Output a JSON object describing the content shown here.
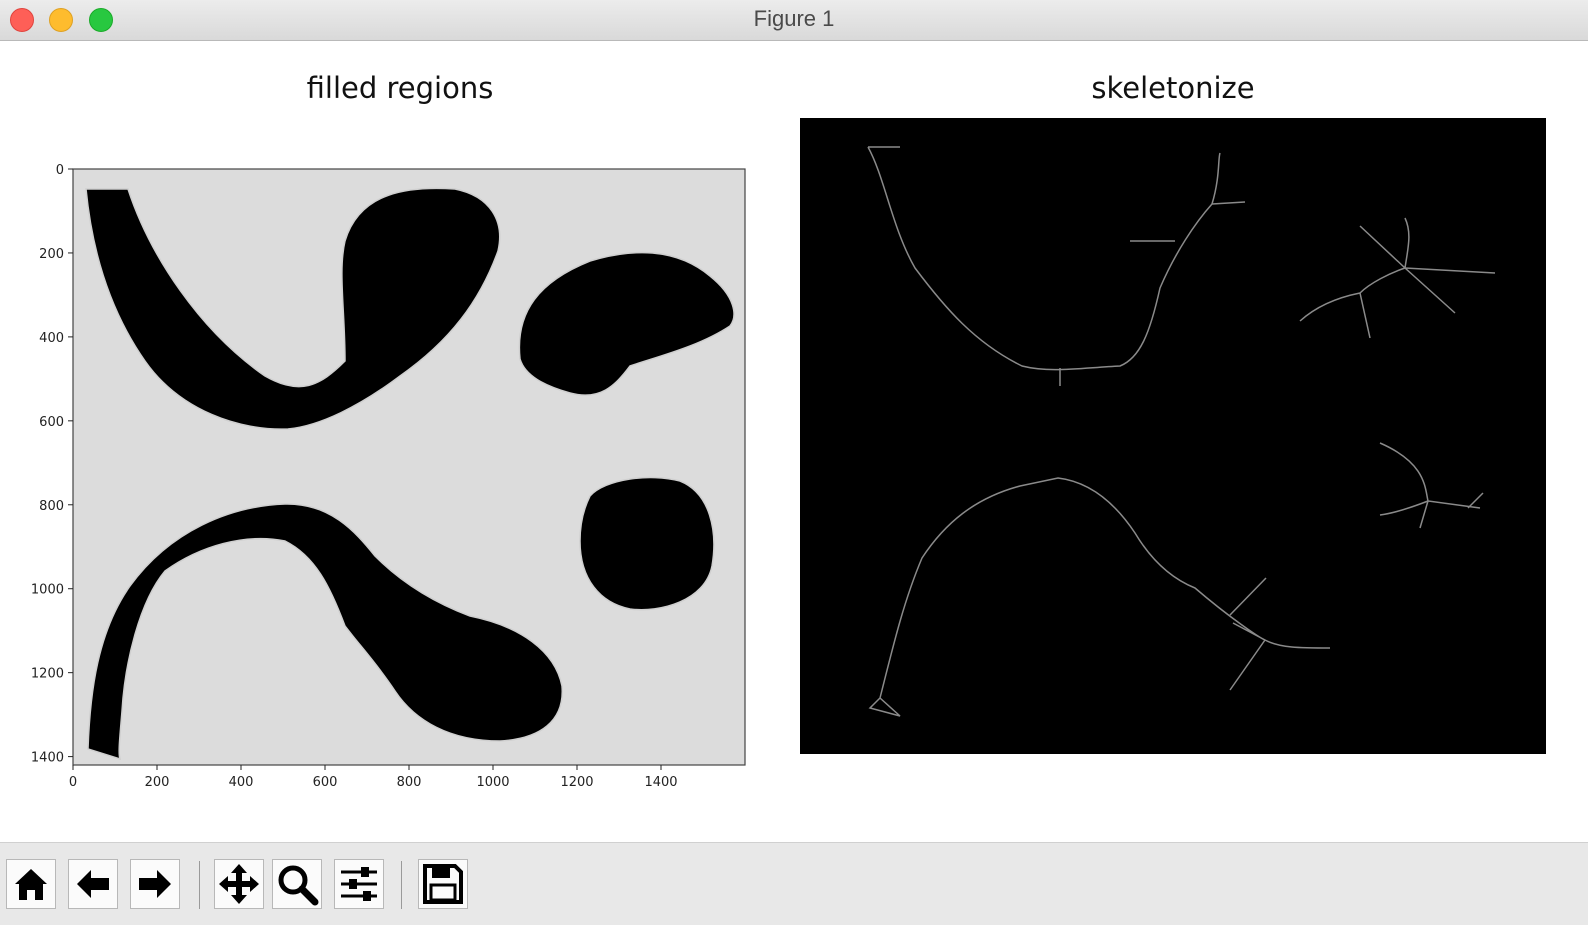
{
  "window": {
    "title": "Figure 1"
  },
  "left_axes": {
    "title": "filled regions",
    "xticks": [
      "0",
      "200",
      "400",
      "600",
      "800",
      "1000",
      "1200",
      "1400"
    ],
    "yticks": [
      "0",
      "200",
      "400",
      "600",
      "800",
      "1000",
      "1200",
      "1400"
    ],
    "background_color": "#dcdcdc",
    "region_color": "#000000"
  },
  "right_axes": {
    "title": "skeletonize",
    "background_color": "#000000",
    "skeleton_color": "#8a8a8a"
  },
  "toolbar": {
    "buttons": [
      {
        "name": "home",
        "icon": "home-icon"
      },
      {
        "name": "back",
        "icon": "arrow-left-icon"
      },
      {
        "name": "forward",
        "icon": "arrow-right-icon"
      },
      {
        "name": "pan",
        "icon": "move-icon"
      },
      {
        "name": "zoom",
        "icon": "magnifier-icon"
      },
      {
        "name": "configure-subplots",
        "icon": "sliders-icon"
      },
      {
        "name": "save",
        "icon": "floppy-disk-icon"
      }
    ]
  }
}
